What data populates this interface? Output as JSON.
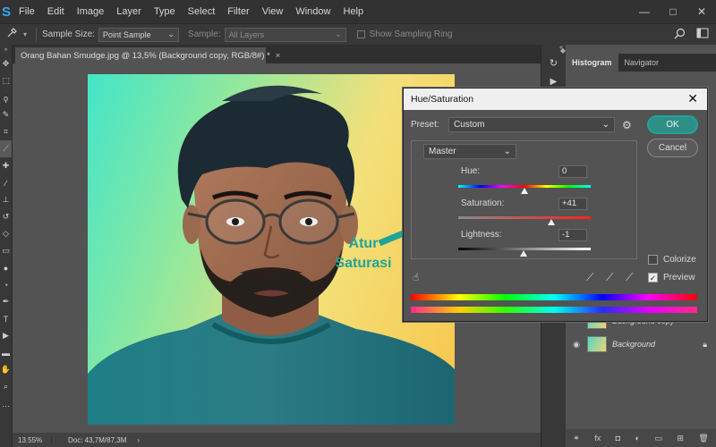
{
  "menu": {
    "app_logo": "S",
    "items": [
      "File",
      "Edit",
      "Image",
      "Layer",
      "Type",
      "Select",
      "Filter",
      "View",
      "Window",
      "Help"
    ]
  },
  "window_controls": {
    "minimize": "—",
    "restore": "□",
    "close": "✕"
  },
  "options_bar": {
    "sample_size_label": "Sample Size:",
    "sample_size_value": "Point Sample",
    "sample_label": "Sample:",
    "sample_value": "All Layers",
    "show_ring_label": "Show Sampling Ring"
  },
  "document_tab": {
    "title": "Orang Bahan Smudge.jpg @ 13,5% (Background copy, RGB/8#) *",
    "close": "×"
  },
  "status_bar": {
    "zoom": "13.55%",
    "doc_info": "Doc: 43,7M/87,3M",
    "arrow": "›"
  },
  "annotation": {
    "line1": "Atur",
    "line2": "Saturasi",
    "color": "#1fa49a"
  },
  "panels": {
    "tabs": [
      "Histogram",
      "Navigator"
    ],
    "layers": [
      {
        "name": "Background copy"
      },
      {
        "name": "Background"
      }
    ]
  },
  "dialog": {
    "title": "Hue/Saturation",
    "close": "✕",
    "preset_label": "Preset:",
    "preset_value": "Custom",
    "channel_value": "Master",
    "ok_label": "OK",
    "cancel_label": "Cancel",
    "hue": {
      "label": "Hue:",
      "value": "0",
      "fraction": 0.5
    },
    "saturation": {
      "label": "Saturation:",
      "value": "+41",
      "fraction": 0.705
    },
    "lightness": {
      "label": "Lightness:",
      "value": "-1",
      "fraction": 0.495
    },
    "colorize_label": "Colorize",
    "preview_label": "Preview",
    "colorize_checked": false,
    "preview_checked": true
  }
}
